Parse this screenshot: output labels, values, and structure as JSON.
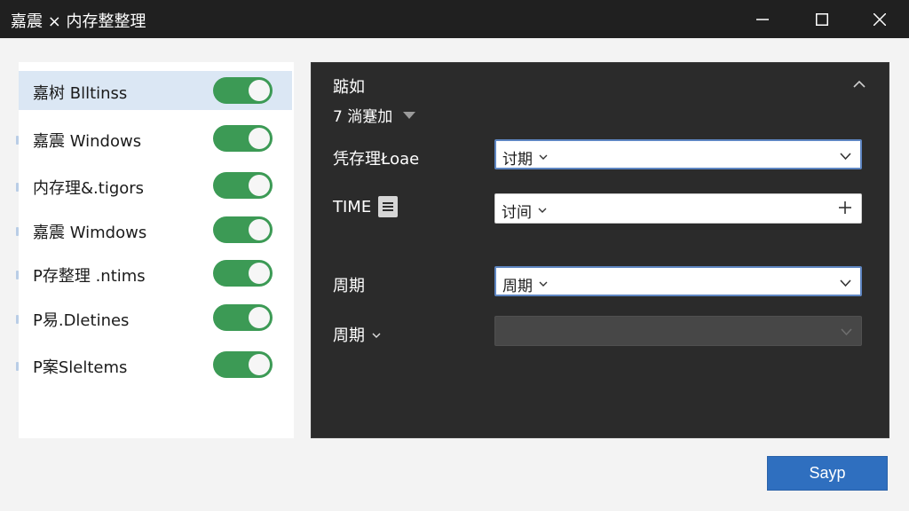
{
  "window": {
    "title": "嘉震 × 内存整整理"
  },
  "sidebar": {
    "items": [
      {
        "label": "嘉树 Blltinss",
        "enabled": true,
        "selected": true
      },
      {
        "label": "嘉震 Windows",
        "enabled": true,
        "selected": false
      },
      {
        "label": "内存理&.tigors",
        "enabled": true,
        "selected": false
      },
      {
        "label": "嘉震 Wimdows",
        "enabled": true,
        "selected": false
      },
      {
        "label": "P存整理 .ntims",
        "enabled": true,
        "selected": false
      },
      {
        "label": "P易.Dletines",
        "enabled": true,
        "selected": false
      },
      {
        "label": "P案Sleltems",
        "enabled": true,
        "selected": false
      }
    ]
  },
  "panel": {
    "title": "踮如",
    "sub_dropdown": "7 淌蹇加",
    "fields": [
      {
        "label": "凭存理Łoae",
        "value": "讨期",
        "state": "focused",
        "right_icon": "chevron-down-icon"
      },
      {
        "label": "TIME",
        "value": "讨间",
        "state": "normal",
        "right_icon": "plus-icon"
      },
      {
        "label": "周期",
        "value": "周期",
        "state": "focused",
        "right_icon": "chevron-down-icon"
      },
      {
        "label": "周期",
        "value": "",
        "state": "disabled",
        "right_icon": "chevron-down-icon"
      }
    ]
  },
  "footer": {
    "save_label": "Sayp"
  },
  "colors": {
    "titlebar": "#202020",
    "toggle_on": "#3c9a55",
    "panel_dark": "#2b2b2b",
    "accent": "#2f6fbf",
    "selected_row": "#dbe7f4"
  }
}
